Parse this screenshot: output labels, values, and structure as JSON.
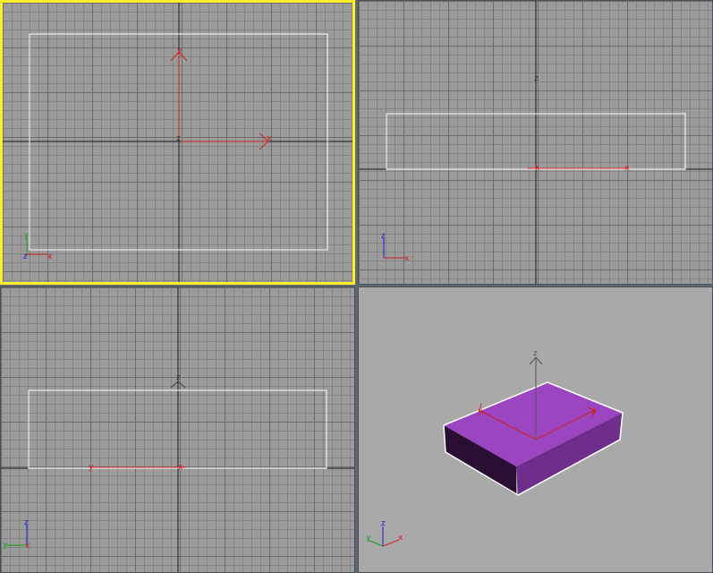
{
  "viewports": [
    {
      "id": "top",
      "active": true,
      "gizmo_labels": {
        "y": "y",
        "x": "x",
        "z": "z"
      },
      "tripod_labels": {
        "y": "y",
        "z": "z",
        "x": "x"
      }
    },
    {
      "id": "front",
      "active": false,
      "gizmo_labels": {
        "z": "z",
        "x": "x",
        "origin": "x"
      },
      "tripod_labels": {
        "z": "z",
        "x": "x"
      }
    },
    {
      "id": "left",
      "active": false,
      "gizmo_labels": {
        "z": "z",
        "y": "y",
        "x": "x"
      },
      "tripod_labels": {
        "z": "z",
        "y": "y",
        "x": "x"
      }
    },
    {
      "id": "perspective",
      "active": false,
      "gizmo_labels": {
        "z": "z",
        "y": "y",
        "x": "x"
      },
      "tripod_labels": {
        "z": "z",
        "y": "y",
        "x": "x"
      }
    }
  ],
  "colors": {
    "active_border": "#ffef2b",
    "box_top": "#9b45c0",
    "box_front": "#6f2e8c",
    "box_side": "#2a0f35",
    "axis_x": "#d22020",
    "axis_y": "#1d9b1d",
    "axis_z": "#1a1ad4",
    "selection": "#ffffff"
  }
}
